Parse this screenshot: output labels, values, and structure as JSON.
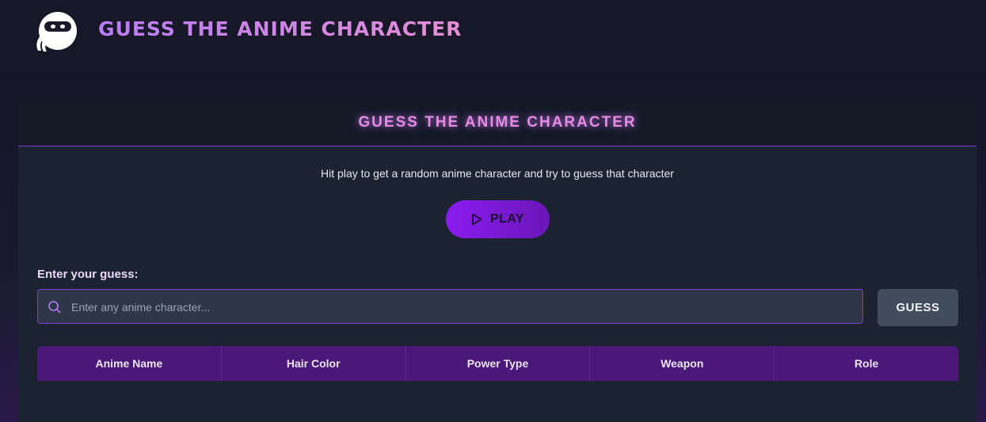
{
  "header": {
    "app_title": "GUESS THE ANIME CHARACTER",
    "logo_icon": "ninja-mascot-icon"
  },
  "card": {
    "title": "GUESS THE ANIME CHARACTER",
    "intro": "Hit play to get a random anime character and try to guess that character",
    "play_label": "PLAY",
    "play_icon": "play-icon"
  },
  "guess": {
    "label": "Enter your guess:",
    "placeholder": "Enter any anime character...",
    "value": "",
    "button_label": "GUESS",
    "search_icon": "search-icon"
  },
  "table": {
    "columns": [
      "Anime Name",
      "Hair Color",
      "Power Type",
      "Weapon",
      "Role"
    ],
    "rows": []
  },
  "colors": {
    "accent": "#8a1cf0",
    "title_pink": "#e48de0",
    "table_header": "#4a1878",
    "card_bg": "#1b2331"
  }
}
